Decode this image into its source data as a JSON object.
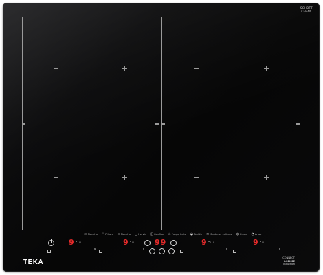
{
  "badge": {
    "line1": "SCHOTT",
    "line2": "CERAN"
  },
  "brand": "TEKA",
  "sense": {
    "line1": "CONNECT",
    "line2": "&SENSE",
    "line3": "induction"
  },
  "modes": [
    {
      "icon": "griddle-icon",
      "glyph": "▭",
      "label": "Plancha"
    },
    {
      "icon": "fry-icon",
      "glyph": "◠",
      "label": "Fritura"
    },
    {
      "icon": "half-griddle-icon",
      "glyph": "▱",
      "label": "Plancha"
    },
    {
      "icon": "pot-icon",
      "glyph": "◡",
      "label": "Hervir"
    },
    {
      "icon": "casserole-icon",
      "glyph": "◫",
      "label": "Confitar"
    },
    {
      "icon": "slow-cook-icon",
      "glyph": "♨",
      "label": "Fuego lento"
    },
    {
      "icon": "wok-icon",
      "glyph": "◒",
      "label": "Sartén"
    },
    {
      "icon": "keep-warm-icon",
      "glyph": "≋",
      "label": "Mantener caliente"
    },
    {
      "icon": "puree-icon",
      "glyph": "◍",
      "label": "Puree"
    },
    {
      "icon": "rice-icon",
      "glyph": "◔",
      "label": "Arroz"
    }
  ],
  "controls": {
    "zone1": {
      "level": "9",
      "icons": "ᵃ⋯"
    },
    "zone2": {
      "level": "9",
      "icons": "ᵃ⋯"
    },
    "timer": {
      "digits": "99"
    },
    "zone3": {
      "level": "9",
      "icons": "ᵃ⋯"
    },
    "zone4": {
      "level": "9",
      "icons": "ᵃ⋯"
    }
  },
  "slider_end_mark": "⁹"
}
